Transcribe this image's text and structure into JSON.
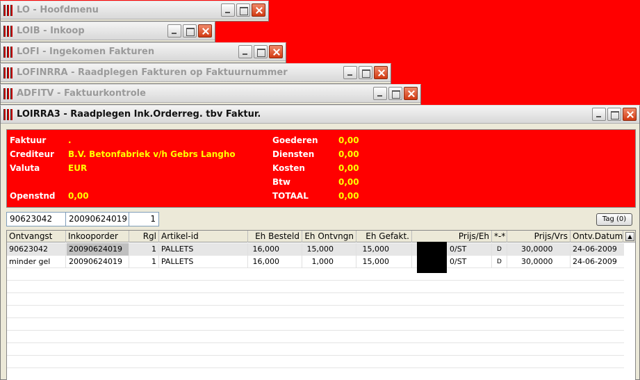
{
  "windows": [
    {
      "title": "LO - Hoofdmenu"
    },
    {
      "title": "LOIB - Inkoop"
    },
    {
      "title": "LOFI - Ingekomen Fakturen"
    },
    {
      "title": "LOFINRRA - Raadplegen Fakturen op Faktuurnummer"
    },
    {
      "title": "ADFITV - Faktuurkontrole"
    },
    {
      "title": "LOIRRA3 - Raadplegen Ink.Orderreg. tbv Faktur."
    }
  ],
  "header": {
    "faktuur_label": "Faktuur",
    "faktuur_value": ".",
    "crediteur_label": "Crediteur",
    "crediteur_value": "B.V. Betonfabriek v/h Gebrs Langho",
    "valuta_label": "Valuta",
    "valuta_value": "EUR",
    "openstnd_label": "Openstnd",
    "openstnd_value": "0,00",
    "goederen_label": "Goederen",
    "goederen_value": "0,00",
    "diensten_label": "Diensten",
    "diensten_value": "0,00",
    "kosten_label": "Kosten",
    "kosten_value": "0,00",
    "btw_label": "Btw",
    "btw_value": "0,00",
    "totaal_label": "TOTAAL",
    "totaal_value": "0,00"
  },
  "filters": {
    "ontvangst": "90623042",
    "inkooporder": "20090624019",
    "regel": "1"
  },
  "tag_button": "Tag (0)",
  "table": {
    "columns": [
      "Ontvangst",
      "Inkooporder",
      "Rgl",
      "Artikel-id",
      "Eh Besteld",
      "Eh Ontvngn",
      "Eh Gefakt.",
      "Prijs/Eh",
      "*-*",
      "Prijs/Vrs",
      "Ontv.Datum"
    ],
    "rows": [
      {
        "ontvangst": "90623042",
        "inkooporder": "20090624019",
        "rgl": "1",
        "artikel": "PALLETS",
        "besteld": "16,000",
        "ontvangen": "15,000",
        "gefakt": "15,000",
        "prijs_eh": "0/ST",
        "flag": "D",
        "prijs_vrs": "30,0000",
        "datum": "24-06-2009"
      },
      {
        "ontvangst": "minder gel",
        "inkooporder": "20090624019",
        "rgl": "1",
        "artikel": "PALLETS",
        "besteld": "16,000",
        "ontvangen": "1,000",
        "gefakt": "15,000",
        "prijs_eh": "0/ST",
        "flag": "D",
        "prijs_vrs": "30,0000",
        "datum": "24-06-2009"
      }
    ]
  }
}
